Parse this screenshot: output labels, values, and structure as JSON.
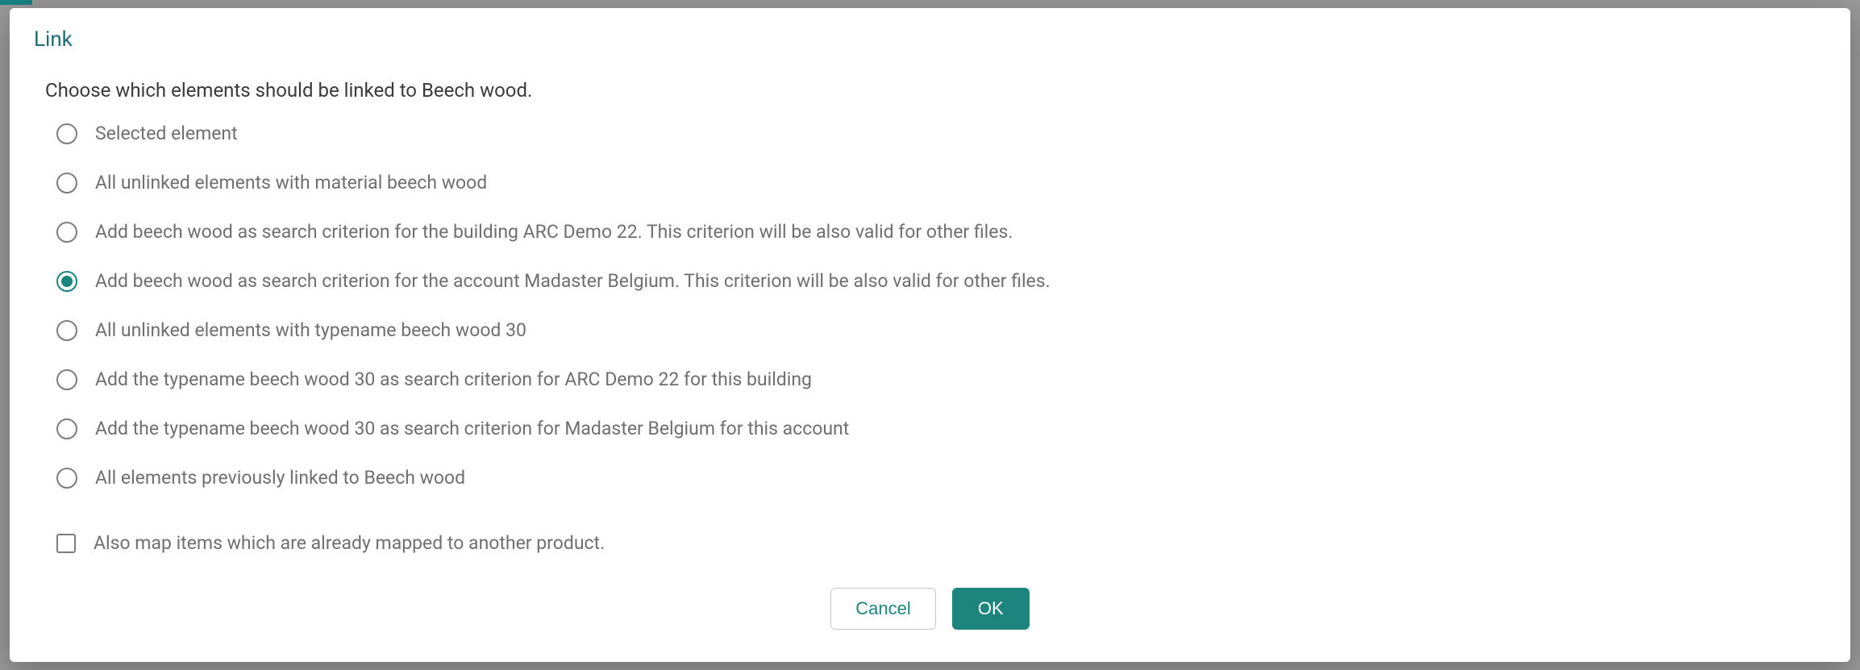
{
  "modal": {
    "title": "Link",
    "subhead": "Choose which elements should be linked to Beech wood.",
    "options": [
      {
        "label": "Selected element",
        "selected": false
      },
      {
        "label": "All unlinked elements with material beech wood",
        "selected": false
      },
      {
        "label": "Add beech wood as search criterion for the building ARC Demo 22. This criterion will be also valid for other files.",
        "selected": false
      },
      {
        "label": "Add beech wood as search criterion for the account Madaster Belgium. This criterion will be also valid for other files.",
        "selected": true
      },
      {
        "label": "All unlinked elements with typename beech wood 30",
        "selected": false
      },
      {
        "label": "Add the typename beech wood 30 as search criterion for ARC Demo 22 for this building",
        "selected": false
      },
      {
        "label": "Add the typename beech wood 30 as search criterion for Madaster Belgium for this account",
        "selected": false
      },
      {
        "label": "All elements previously linked to Beech wood",
        "selected": false
      }
    ],
    "checkbox": {
      "label": "Also map items which are already mapped to another product.",
      "checked": false
    },
    "buttons": {
      "cancel": "Cancel",
      "ok": "OK"
    }
  }
}
